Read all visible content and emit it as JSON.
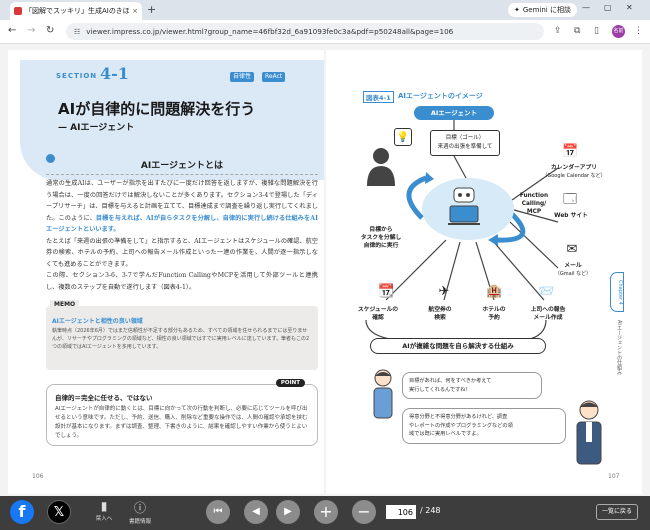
{
  "browser": {
    "tab_title": "「図解でスッキリ」生成AIのきほんが",
    "tab_close": "×",
    "new_tab": "+",
    "gemini_label": "Gemini に相談",
    "url": "viewer.impress.co.jp/viewer.html?group_name=46fbf32d_6a91093fe0c3a&pdf=p50248all&page=106",
    "avatar": "名前"
  },
  "left_page": {
    "section_label": "SECTION",
    "section_number": "4-1",
    "tags": [
      "自律性",
      "ReAct"
    ],
    "title": "AIが自律的に問題解決を行う",
    "subtitle": "— AIエージェント",
    "heading": "AIエージェントとは",
    "para1": "通常の生成AIは、ユーザーが指示を出すたびに一度だけ回答を返しますが、複雑な問題解決を行う場合は、一度の回答だけでは解決しないことが多くあります。セクション3-4で登場した「ディープリサーチ」は、目標を与えると計画を立てて、目標達成まで調査を繰り返し実行してくれました。このように、",
    "para1_hl": "目標を与えれば、AIが自らタスクを分解し、自律的に実行し続ける仕組みをAIエージェントといいます。",
    "para2": "たとえば「来週の出張の準備をして」と指示すると、AIエージェントはスケジュールの確認、航空券の検索、ホテルの予約、上司への報告メール作成といった一連の作業を、人間が逐一指示しなくても進めることができます。",
    "para3": "この際、セクション3-6、3-7で学んだFunction CallingやMCPを活用して外部ツールと連携し、複数のステップを自動で遂行します（図表4-1）。",
    "memo_header": "MEMO",
    "memo_title": "AIエージェントと相性の良い領域",
    "memo_body": "執筆時点（2026年6月）ではまだ信頼性が不足する部分もあるため、すべての領域を任せられるまでには至りませんが、リサーチやプログラミングの領域など、相性の良い領域ではすでに実用レベルに達しています。筆者もこの2つの領域ではAIエージェントを多用しています。",
    "point_badge": "POINT",
    "point_title": "自律的＝完全に任せる、ではない",
    "point_body": "AIエージェントが自律的に動くとは、目標に向かって次の行動を判断し、必要に応じてツールを呼び出せるという意味です。ただし、予約、送信、購入、削除など重要な操作では、人間の確認や承認を挟む設計が基本になります。まずは調査、整理、下書きのように、結果を確認しやすい作業から使うとよいでしょう。",
    "page_number": "106"
  },
  "right_page": {
    "figure_label": "図表4-1",
    "figure_title": "AIエージェントのイメージ",
    "agent_label": "AIエージェント",
    "goal_label": "目標（ゴール）",
    "goal_text": "来週の出張を準備して",
    "left_action": "目標から\nタスクを分解し\n自律的に実行",
    "function_label": "Function\nCalling/\nMCP",
    "tool_calendar": "カレンダーアプリ",
    "tool_calendar_sub": "（Google Calendar など）",
    "tool_web": "Web サイト",
    "tool_mail": "メール",
    "tool_mail_sub": "（Gmail など）",
    "tasks": [
      "スケジュールの\n確認",
      "航空券の\n検索",
      "ホテルの\n予約",
      "上司への報告\nメール作成"
    ],
    "bottom_pill": "AIが複雑な問題を自ら解決する仕組み",
    "bubble1": "目標があれば、何をすべきか考えて\n実行してくれるんですね！",
    "bubble2": "得意分野と不得意分野があるけれど、調査\nやレポートの作成やプログラミングなどの領\n域では既に実用レベルですよ。",
    "side_tab": "Chapter 4",
    "side_text": "AIエージェントの仕組み",
    "page_number": "107"
  },
  "bottombar": {
    "facebook": "f",
    "x": "𝕏",
    "bookmark_label": "栞入へ",
    "info_label": "書籍情報",
    "current_page": "106",
    "total_pages": "/ 248",
    "list_button": "一覧に戻る"
  },
  "colors": {
    "accent": "#3a8dcf",
    "section_bg": "#dbe9f6",
    "bottombar": "#3d3d3d"
  }
}
